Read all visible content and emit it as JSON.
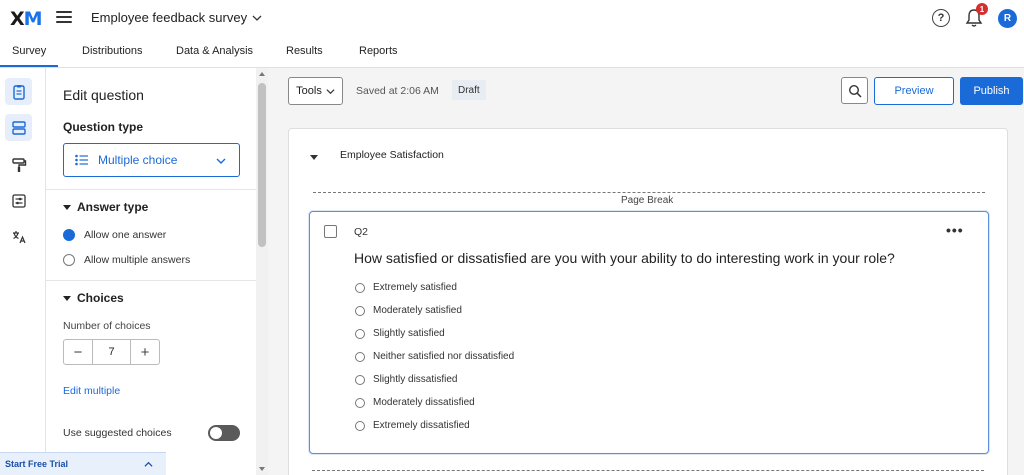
{
  "header": {
    "logo_main": "X",
    "logo_accent": "M",
    "survey_title": "Employee feedback survey",
    "help_glyph": "?",
    "notification_count": "1",
    "avatar_initial": "R"
  },
  "tabs": [
    {
      "label": "Survey",
      "active": true
    },
    {
      "label": "Distributions"
    },
    {
      "label": "Data & Analysis"
    },
    {
      "label": "Results"
    },
    {
      "label": "Reports"
    }
  ],
  "rail": [
    "survey-flow-icon",
    "blocks-icon",
    "paint-roller-icon",
    "options-icon",
    "translate-icon"
  ],
  "panel": {
    "title": "Edit question",
    "question_type_label": "Question type",
    "question_type_value": "Multiple choice",
    "answer_type_label": "Answer type",
    "answer_options": [
      "Allow one answer",
      "Allow multiple answers"
    ],
    "choices_label": "Choices",
    "number_of_choices_label": "Number of choices",
    "number_of_choices": "7",
    "minus": "−",
    "plus": "+",
    "edit_multiple": "Edit multiple",
    "suggested_choices_label": "Use suggested choices"
  },
  "trial": {
    "label": "Start Free Trial"
  },
  "toolbar": {
    "tools_label": "Tools",
    "saved_text": "Saved at 2:06 AM",
    "draft_label": "Draft",
    "preview_label": "Preview",
    "publish_label": "Publish"
  },
  "block": {
    "title": "Employee Satisfaction",
    "page_break_label": "Page Break",
    "question": {
      "id": "Q2",
      "more": "•••",
      "text": "How satisfied or dissatisfied are you with your ability to do interesting work in your role?",
      "choices": [
        "Extremely satisfied",
        "Moderately satisfied",
        "Slightly satisfied",
        "Neither satisfied nor dissatisfied",
        "Slightly dissatisfied",
        "Moderately dissatisfied",
        "Extremely dissatisfied"
      ]
    }
  },
  "colors": {
    "accent": "#1a6ad8",
    "badge": "#d32f2f"
  }
}
